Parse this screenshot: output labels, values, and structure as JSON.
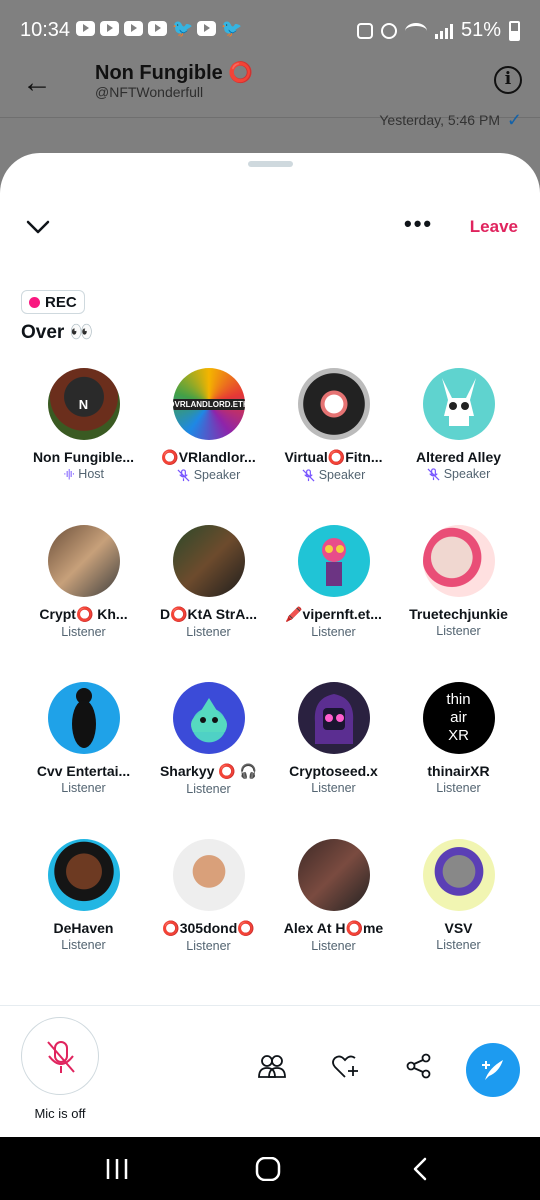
{
  "status_bar": {
    "time": "10:34",
    "battery": "51%"
  },
  "dm": {
    "title": "Non Fungible ⭕",
    "handle": "@NFTWonderfull",
    "timestamp": "Yesterday, 5:46 PM"
  },
  "space": {
    "leave_label": "Leave",
    "rec_label": "REC",
    "title": "Over 👀"
  },
  "participants": [
    {
      "name": "Non Fungible...",
      "role": "Host",
      "role_icon": "sound-wave-icon"
    },
    {
      "name": "⭕VRlandlor...",
      "role": "Speaker",
      "role_icon": "mic-muted-icon"
    },
    {
      "name": "Virtual⭕Fitn...",
      "role": "Speaker",
      "role_icon": "mic-muted-icon"
    },
    {
      "name": "Altered Alley",
      "role": "Speaker",
      "role_icon": "mic-muted-icon"
    },
    {
      "name": "Crypt⭕ Kh...",
      "role": "Listener"
    },
    {
      "name": "D⭕KtA StrA...",
      "role": "Listener"
    },
    {
      "name": "🖍️vipernft.et...",
      "role": "Listener"
    },
    {
      "name": "Truetechjunkie",
      "role": "Listener"
    },
    {
      "name": "Cvv Entertai...",
      "role": "Listener"
    },
    {
      "name": "Sharkyy ⭕ 🎧",
      "role": "Listener"
    },
    {
      "name": "Cryptoseed.x",
      "role": "Listener"
    },
    {
      "name": "thinairXR",
      "role": "Listener"
    },
    {
      "name": "DeHaven",
      "role": "Listener"
    },
    {
      "name": "⭕305dond⭕",
      "role": "Listener"
    },
    {
      "name": "Alex At H⭕me",
      "role": "Listener"
    },
    {
      "name": "VSV",
      "role": "Listener"
    }
  ],
  "avatar_text": {
    "vrlandlord": "OVRLANDLORD.ETH",
    "thinair": [
      "thin",
      "air",
      "XR"
    ]
  },
  "bottom_bar": {
    "mic_label": "Mic is off"
  },
  "colors": {
    "accent": "#1d9bf0",
    "leave": "#e0245e",
    "rec_dot": "#f91880",
    "host_wave": "#7856ff"
  }
}
